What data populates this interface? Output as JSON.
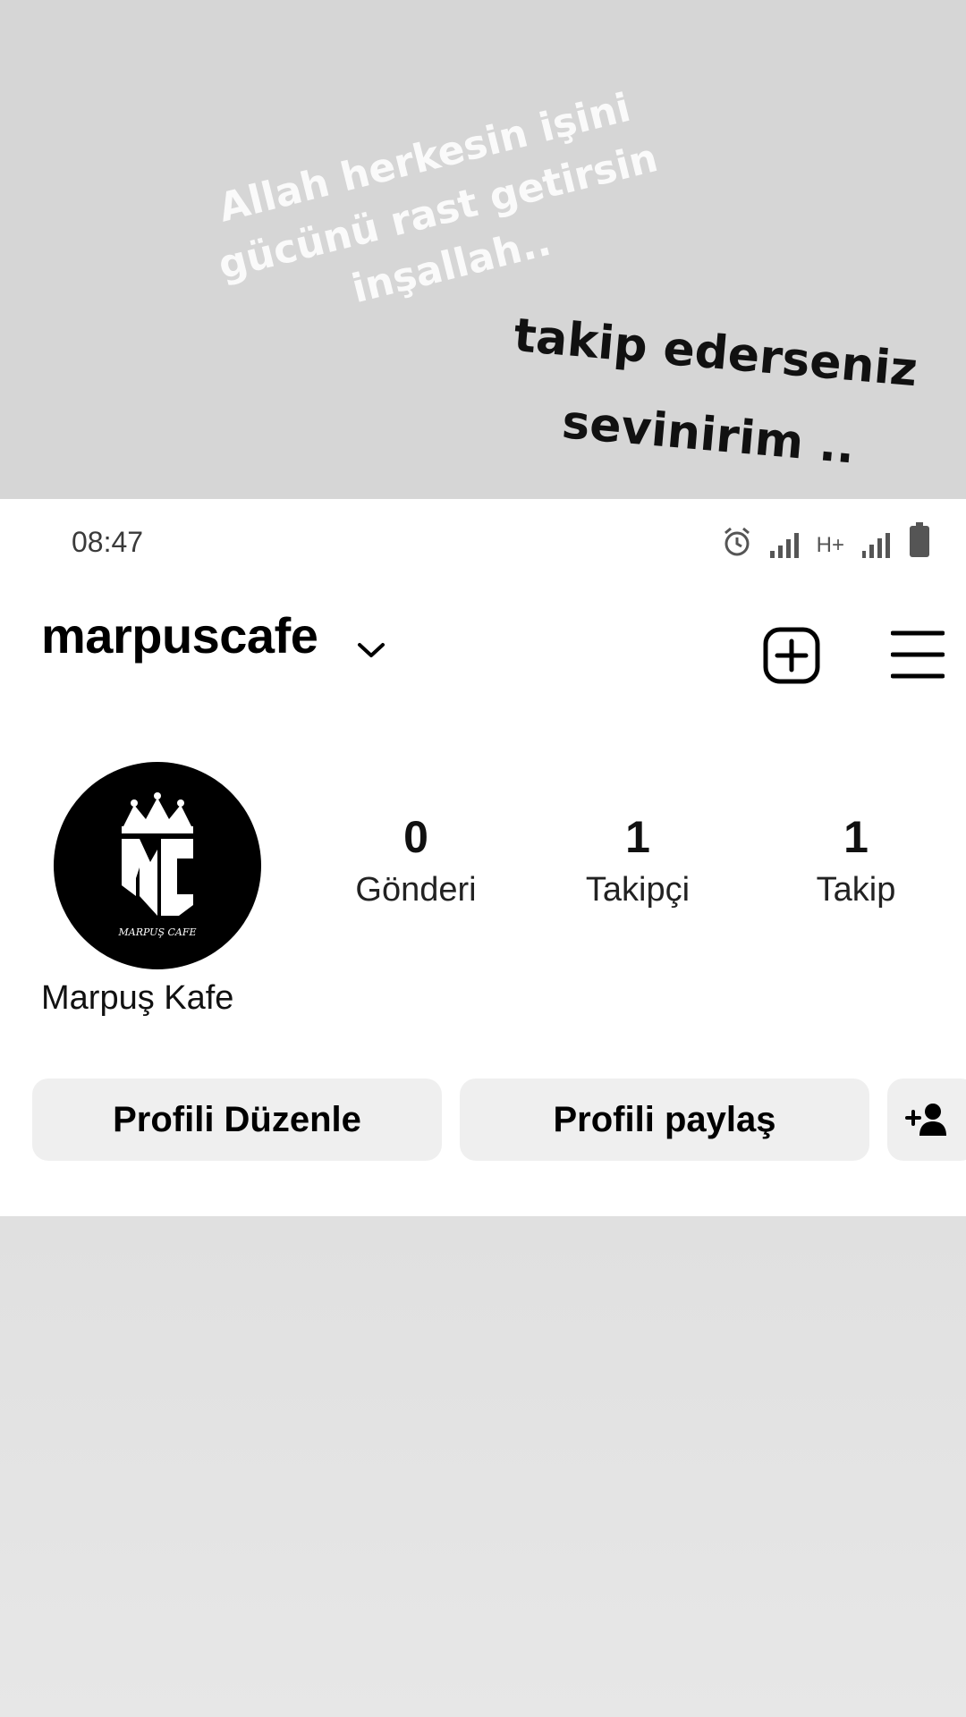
{
  "story_overlay": {
    "white_lines": [
      "Allah herkesin işini",
      "gücünü rast getirsin",
      "inşallah.."
    ],
    "black_lines": [
      "takip ederseniz",
      "sevinirim .."
    ]
  },
  "status_bar": {
    "time": "08:47",
    "network_label": "H+",
    "icons": [
      "alarm-icon",
      "signal-icon",
      "signal-icon",
      "battery-icon"
    ]
  },
  "header": {
    "username": "marpuscafe",
    "icons": [
      "chevron-down-icon",
      "add-post-icon",
      "menu-icon"
    ]
  },
  "profile": {
    "avatar_logo": {
      "monogram": "MC",
      "caption": "MARPUŞ CAFE"
    },
    "display_name": "Marpuş Kafe",
    "stats": [
      {
        "value": "0",
        "label": "Gönderi"
      },
      {
        "value": "1",
        "label": "Takipçi"
      },
      {
        "value": "1",
        "label": "Takip"
      }
    ]
  },
  "actions": {
    "edit_label": "Profili Düzenle",
    "share_label": "Profili paylaş",
    "discover_icon": "add-person-icon"
  }
}
